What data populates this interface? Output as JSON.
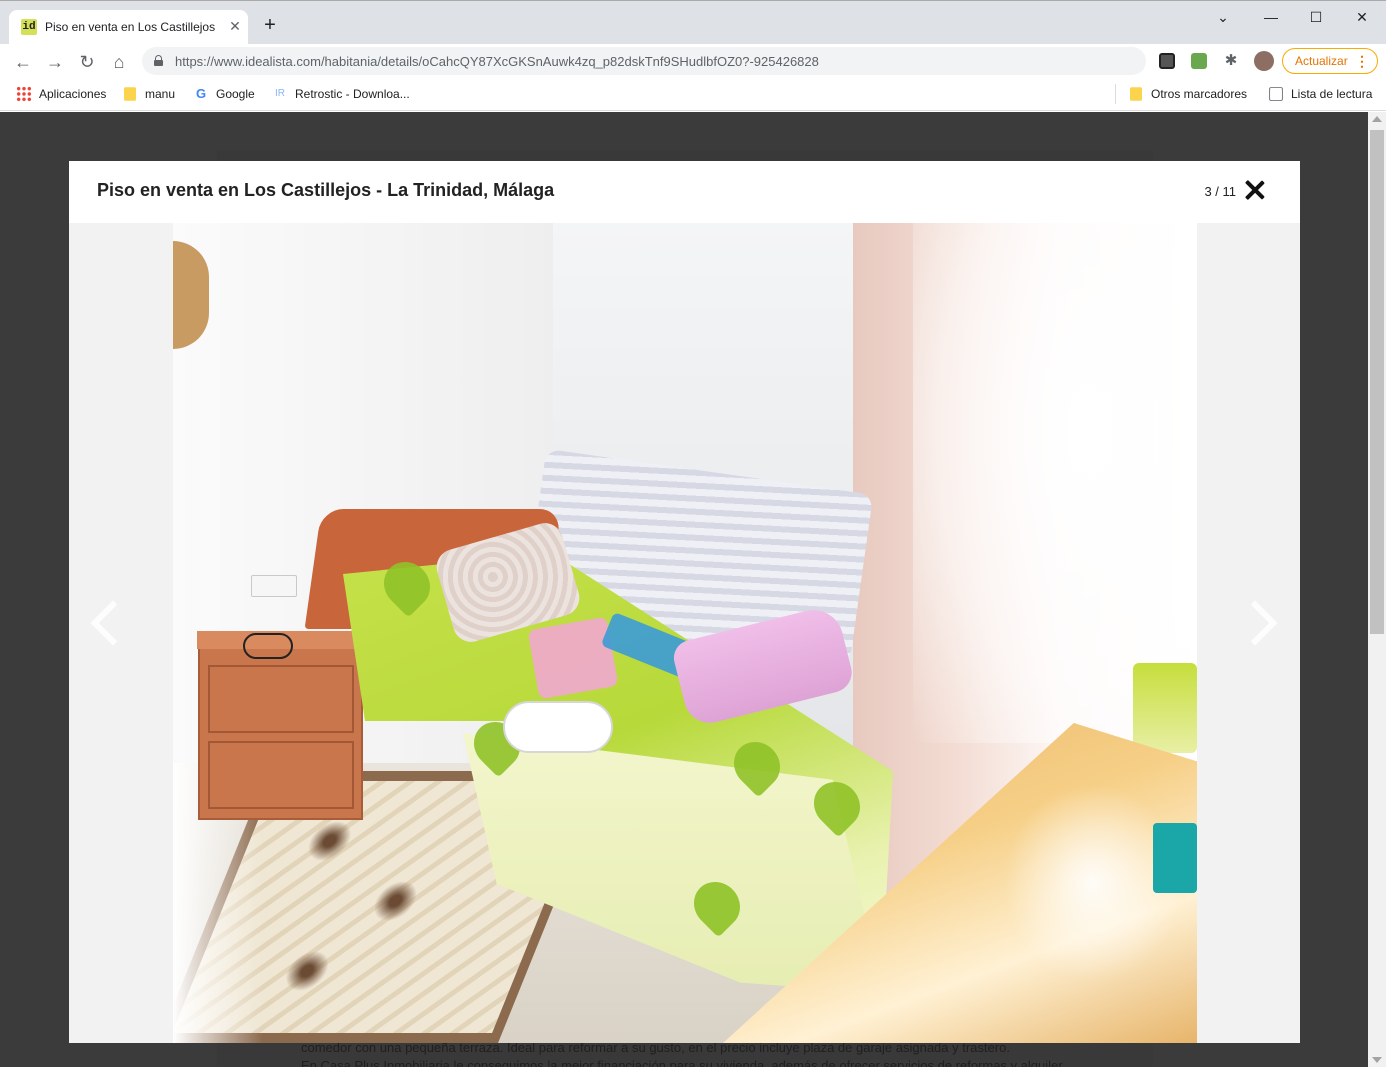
{
  "browser": {
    "tab": {
      "title": "Piso en venta en Los Castillejos - La Trinidad, Málaga — idealista",
      "favicon": "id"
    },
    "window_controls": {
      "minimize": "—",
      "maximize": "☐",
      "close": "✕",
      "tab_list": "⌄"
    },
    "url": "https://www.idealista.com/habitania/details/oCahcQY87XcGKSnAuwk4zq_p82dskTnf9SHudlbfOZ0?-925426828",
    "update_button": "Actualizar",
    "bookmarks": [
      {
        "label": "Aplicaciones",
        "icon": "apps-grid-icon"
      },
      {
        "label": "manu",
        "icon": "folder-icon"
      },
      {
        "label": "Google",
        "icon": "google-icon"
      },
      {
        "label": "Retrostic - Downloa...",
        "icon": "retrostic-icon"
      }
    ],
    "bookmarks_right": [
      {
        "label": "Otros marcadores",
        "icon": "folder-icon"
      },
      {
        "label": "Lista de lectura",
        "icon": "reading-list-icon"
      }
    ]
  },
  "modal": {
    "title": "Piso en venta en Los Castillejos - La Trinidad, Málaga",
    "counter": "3 / 11"
  },
  "underlay": {
    "line1": "comedor con una pequeña terraza. Ideal para reformar a su gusto, en el precio incluye plaza de garaje asignada y trastero.",
    "line2": "En Casa Plus Inmobiliaria le conseguimos la mejor financiación para su vivienda, además de ofrecer servicios de reformas y alquiler."
  },
  "colors": {
    "overlay": "#3b3b3b",
    "accent_update": "#e37400",
    "favicon_bg": "#d4e157"
  }
}
